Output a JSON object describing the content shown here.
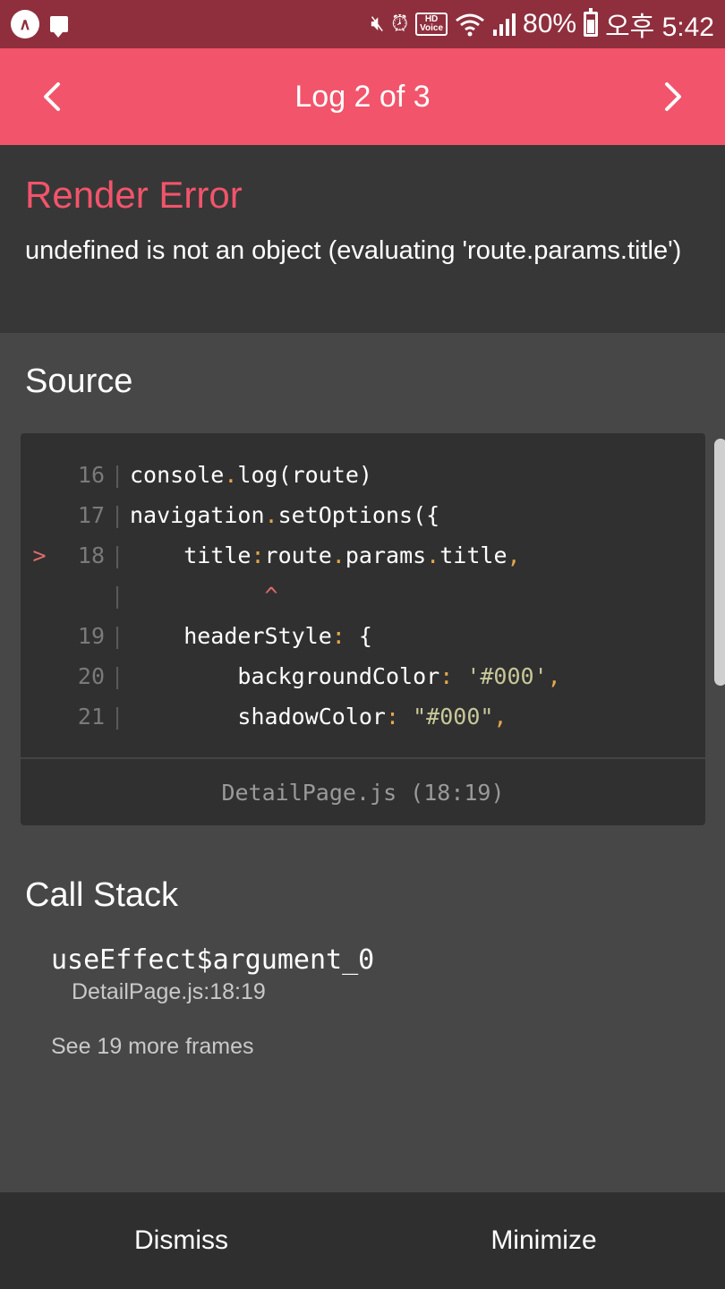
{
  "status_bar": {
    "battery": "80%",
    "time": "오후 5:42",
    "hd_label": "HD",
    "hd_sub": "Voice",
    "app_glyph": "∧",
    "icons": [
      "app-icon",
      "message-icon",
      "mute-icon",
      "alarm-icon",
      "hd-voice-icon",
      "wifi-icon",
      "signal-icon",
      "battery-icon"
    ]
  },
  "header": {
    "title": "Log 2 of 3",
    "prev_icon": "chevron-left-icon",
    "next_icon": "chevron-right-icon"
  },
  "error": {
    "title": "Render Error",
    "message": "undefined is not an object (evaluating 'route.params.title')"
  },
  "source": {
    "heading": "Source",
    "lines": [
      {
        "marker": "",
        "num": "16",
        "bar": "|",
        "code": "console.log(route)"
      },
      {
        "marker": "",
        "num": "17",
        "bar": "|",
        "code": "navigation.setOptions({"
      },
      {
        "marker": ">",
        "num": "18",
        "bar": "|",
        "code": "    title:route.params.title,"
      },
      {
        "marker": "",
        "num": "",
        "bar": "|",
        "code": "          ^"
      },
      {
        "marker": "",
        "num": "19",
        "bar": "|",
        "code": "    headerStyle: {"
      },
      {
        "marker": "",
        "num": "20",
        "bar": "|",
        "code": "        backgroundColor: '#000',"
      },
      {
        "marker": "",
        "num": "21",
        "bar": "|",
        "code": "        shadowColor: \"#000\","
      }
    ],
    "file_ref": "DetailPage.js (18:19)"
  },
  "call_stack": {
    "heading": "Call Stack",
    "frame_name": "useEffect$argument_0",
    "frame_location": "DetailPage.js:18:19",
    "more_frames": "See 19 more frames"
  },
  "footer": {
    "dismiss": "Dismiss",
    "minimize": "Minimize"
  },
  "colors": {
    "accent": "#f2546b",
    "status_bar": "#8f2f3d",
    "background": "#474747",
    "error_panel": "#373737",
    "code_background": "#303030",
    "footer": "#2f2f2f"
  }
}
